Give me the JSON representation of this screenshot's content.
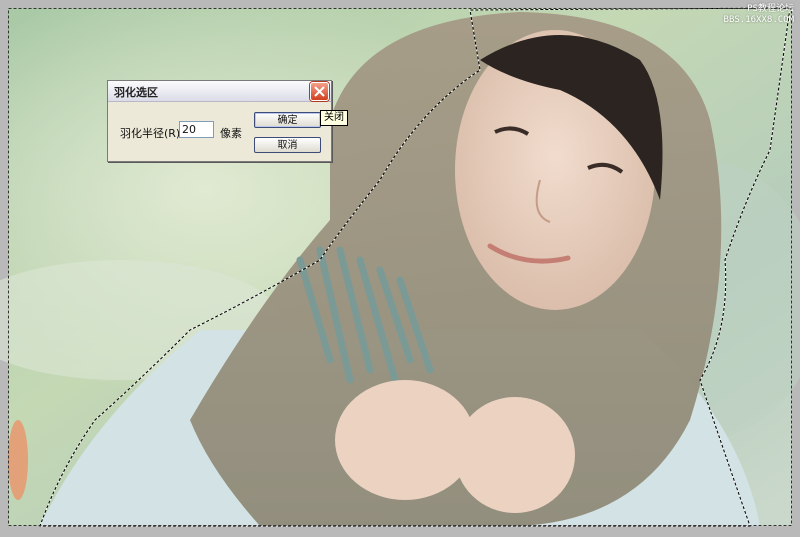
{
  "watermark": {
    "line1": "PS教程论坛",
    "line2": "BBS.16XX8.COM"
  },
  "dialog": {
    "title": "羽化选区",
    "radius_label": "羽化半径(R):",
    "radius_value": "20",
    "unit_label": "像素",
    "ok_label": "确定",
    "cancel_label": "取消",
    "close_tooltip": "关闭"
  },
  "icons": {
    "close": "close-icon"
  },
  "colors": {
    "close_button": "#d84a28",
    "dialog_background": "#ece9d8"
  }
}
